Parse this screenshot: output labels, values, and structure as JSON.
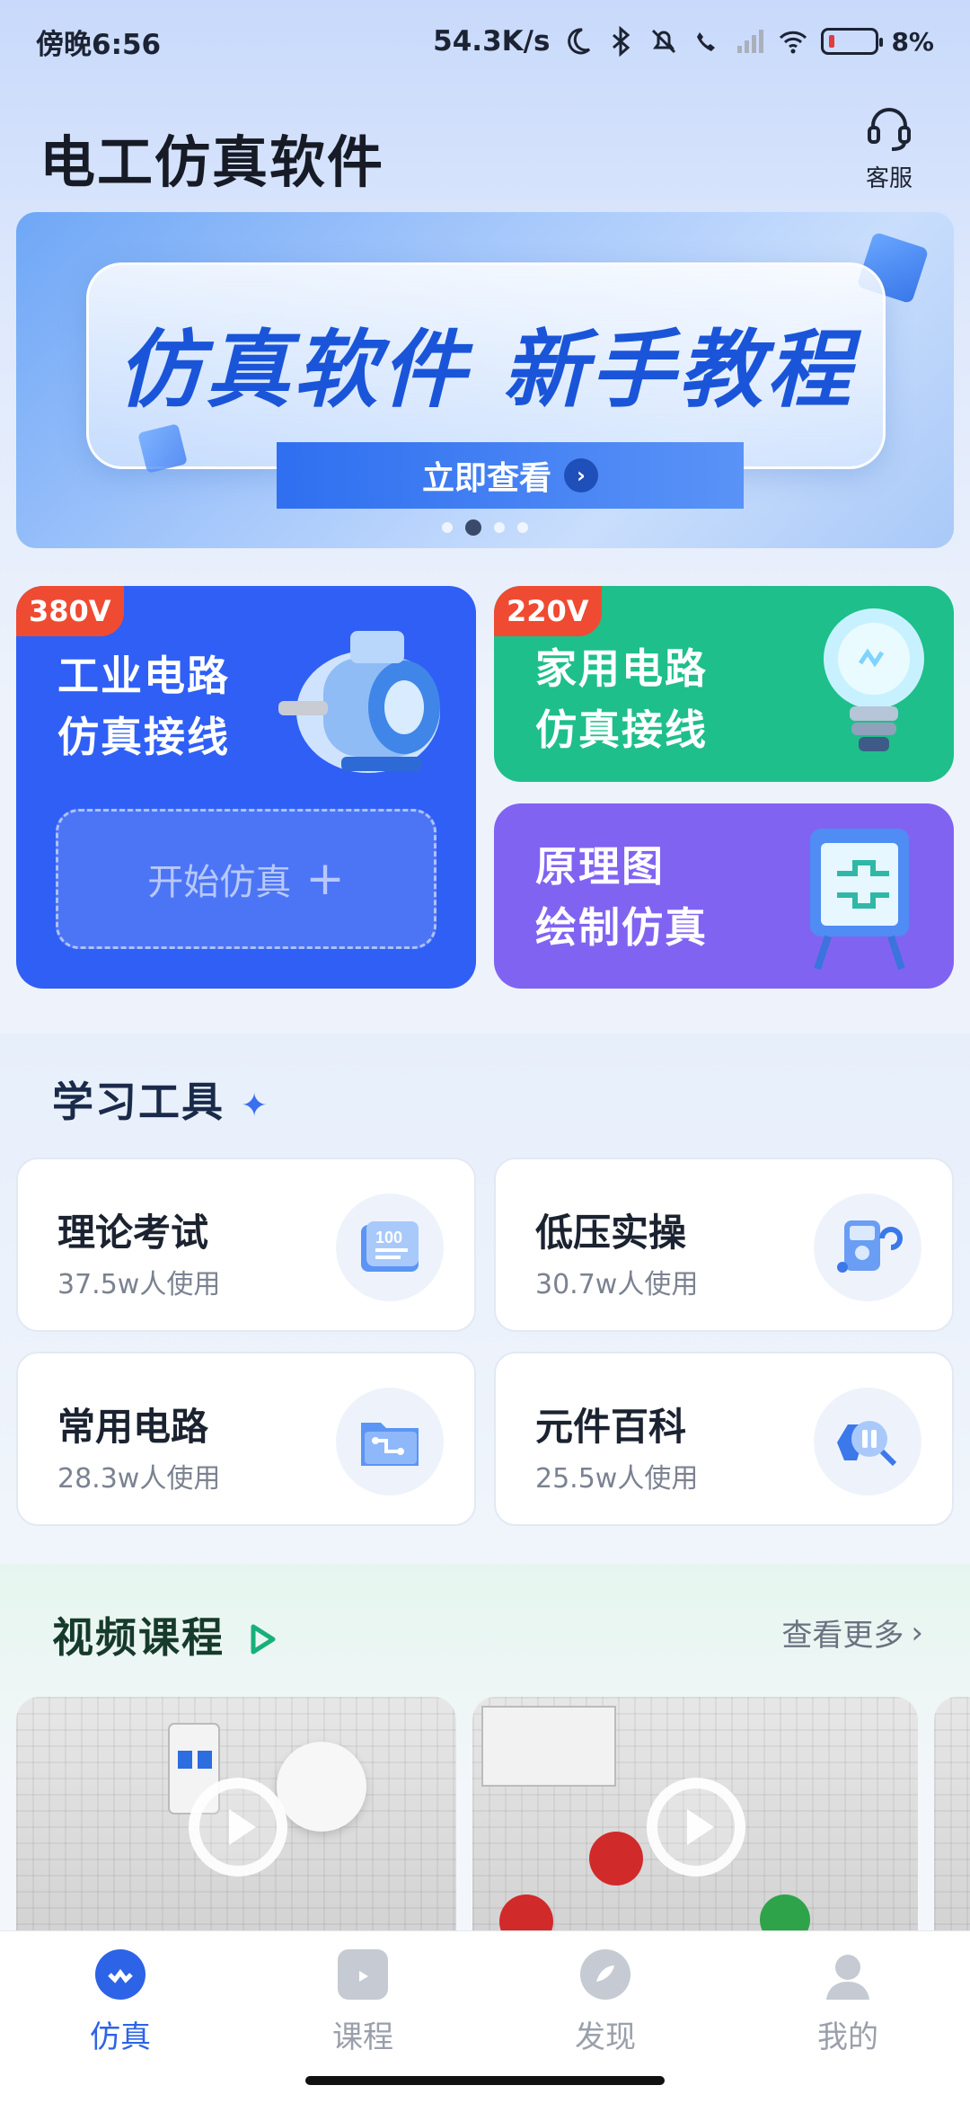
{
  "status_bar": {
    "time": "傍晚6:56",
    "net_speed": "54.3K/s",
    "battery": "8%"
  },
  "header": {
    "title": "电工仿真软件",
    "service_label": "客服"
  },
  "banner": {
    "title": "仿真软件 新手教程",
    "button_label": "立即查看",
    "page_count": 4,
    "active_page": 2
  },
  "sim_cards": {
    "industrial": {
      "tag": "380V",
      "line1": "工业电路",
      "line2": "仿真接线",
      "start_label": "开始仿真"
    },
    "household": {
      "tag": "220V",
      "line1": "家用电路",
      "line2": "仿真接线"
    },
    "schematic": {
      "line1": "原理图",
      "line2": "绘制仿真"
    }
  },
  "tools": {
    "title": "学习工具",
    "items": [
      {
        "name": "理论考试",
        "users": "37.5w人使用",
        "icon": "exam-100-icon"
      },
      {
        "name": "低压实操",
        "users": "30.7w人使用",
        "icon": "multimeter-icon"
      },
      {
        "name": "常用电路",
        "users": "28.3w人使用",
        "icon": "circuit-folder-icon"
      },
      {
        "name": "元件百科",
        "users": "25.5w人使用",
        "icon": "component-search-icon"
      }
    ]
  },
  "videos": {
    "title": "视频课程",
    "more_label": "查看更多"
  },
  "tabbar": {
    "items": [
      {
        "label": "仿真",
        "icon": "simulation-icon",
        "active": true
      },
      {
        "label": "课程",
        "icon": "tv-icon",
        "active": false
      },
      {
        "label": "发现",
        "icon": "compass-icon",
        "active": false
      },
      {
        "label": "我的",
        "icon": "user-icon",
        "active": false
      }
    ]
  },
  "colors": {
    "primary": "#2d63e6",
    "industrial": "#2f5ff5",
    "household": "#1ebf8a",
    "schematic": "#8163f2",
    "tag": "#ef4b32"
  }
}
